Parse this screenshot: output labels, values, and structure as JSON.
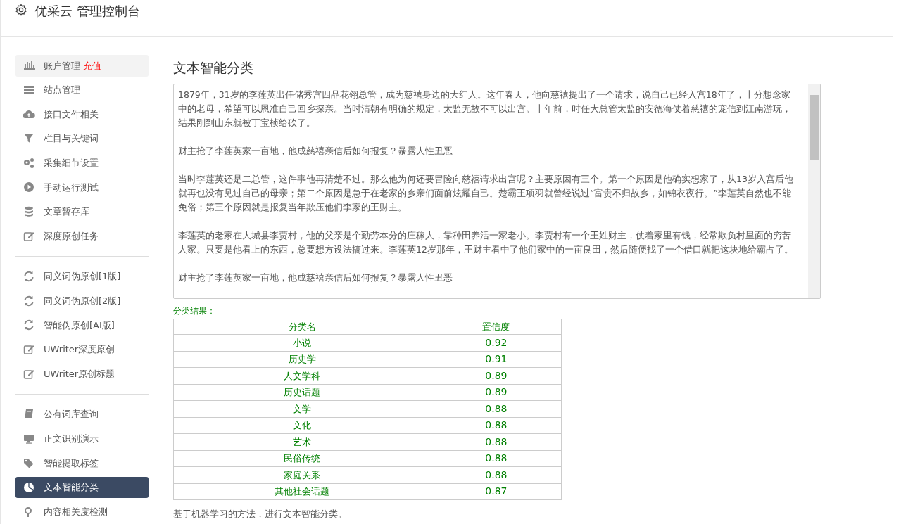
{
  "header": {
    "title": "优采云 管理控制台"
  },
  "sidebar": {
    "groups": [
      {
        "items": [
          {
            "label": "账户管理",
            "badge": "充值",
            "highlighted": true,
            "selected": false
          },
          {
            "label": "站点管理",
            "highlighted": false,
            "selected": false
          },
          {
            "label": "接口文件相关",
            "highlighted": false,
            "selected": false
          },
          {
            "label": "栏目与关键词",
            "highlighted": false,
            "selected": false
          },
          {
            "label": "采集细节设置",
            "highlighted": false,
            "selected": false
          },
          {
            "label": "手动运行测试",
            "highlighted": false,
            "selected": false
          },
          {
            "label": "文章暂存库",
            "highlighted": false,
            "selected": false
          },
          {
            "label": "深度原创任务",
            "highlighted": false,
            "selected": false
          }
        ]
      },
      {
        "items": [
          {
            "label": "同义词伪原创[1版]",
            "highlighted": false,
            "selected": false
          },
          {
            "label": "同义词伪原创[2版]",
            "highlighted": false,
            "selected": false
          },
          {
            "label": "智能伪原创[AI版]",
            "highlighted": false,
            "selected": false
          },
          {
            "label": "UWriter深度原创",
            "highlighted": false,
            "selected": false
          },
          {
            "label": "UWriter原创标题",
            "highlighted": false,
            "selected": false
          }
        ]
      },
      {
        "items": [
          {
            "label": "公有词库查询",
            "highlighted": false,
            "selected": false
          },
          {
            "label": "正文识别演示",
            "highlighted": false,
            "selected": false
          },
          {
            "label": "智能提取标签",
            "highlighted": false,
            "selected": false
          },
          {
            "label": "文本智能分类",
            "highlighted": false,
            "selected": true
          },
          {
            "label": "内容相关度检测",
            "highlighted": false,
            "selected": false
          }
        ]
      }
    ]
  },
  "main": {
    "title": "文本智能分类",
    "text_input": {
      "paragraphs": [
        "1879年，31岁的李莲英出任储秀宫四品花翎总管，成为慈禧身边的大红人。这年春天，他向慈禧提出了一个请求，说自己已经入宫18年了，十分想念家中的老母，希望可以恩准自己回乡探亲。当时清朝有明确的规定，太监无故不可以出宫。十年前，时任大总管太监的安德海仗着慈禧的宠信到江南游玩，结果刚到山东就被丁宝桢给砍了。",
        "财主抢了李莲英家一亩地，他成慈禧亲信后如何报复？暴露人性丑恶",
        "当时李莲英还是二总管，这件事他再清楚不过。那么他为何还要冒险向慈禧请求出宫呢？主要原因有三个。第一个原因是他确实想家了，从13岁入宫后他就再也没有见过自己的母亲；第二个原因是急于在老家的乡亲们面前炫耀自己。楚霸王项羽就曾经说过“富贵不归故乡，如锦衣夜行。”李莲英自然也不能免俗；第三个原因就是报复当年欺压他们李家的王财主。",
        "李莲英的老家在大城县李贾村，他的父亲是个勤劳本分的庄稼人，靠种田养活一家老小。李贾村有一个王姓财主，仗着家里有钱，经常欺负村里面的穷苦人家。只要是他看上的东西，总要想方设法搞过来。李莲英12岁那年，王财主看中了他们家中的一亩良田，然后随便找了一个借口就把这块地给霸占了。",
        "财主抢了李莲英家一亩地，他成慈禧亲信后如何报复？暴露人性丑恶"
      ]
    },
    "result_label": "分类结果：",
    "table": {
      "columns": [
        "分类名",
        "置信度"
      ],
      "rows": [
        [
          "小说",
          "0.92"
        ],
        [
          "历史学",
          "0.91"
        ],
        [
          "人文学科",
          "0.89"
        ],
        [
          "历史话题",
          "0.89"
        ],
        [
          "文学",
          "0.88"
        ],
        [
          "文化",
          "0.88"
        ],
        [
          "艺术",
          "0.88"
        ],
        [
          "民俗传统",
          "0.88"
        ],
        [
          "家庭关系",
          "0.88"
        ],
        [
          "其他社会话题",
          "0.87"
        ]
      ]
    },
    "footnote": "基于机器学习的方法，进行文本智能分类。"
  }
}
